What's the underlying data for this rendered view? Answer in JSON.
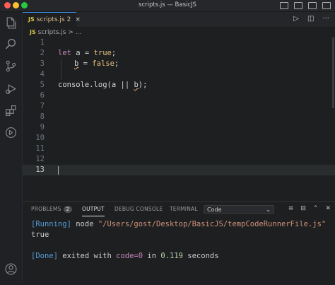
{
  "window": {
    "title": "scripts.js — BasicJS"
  },
  "tab": {
    "lang_badge": "JS",
    "name": "scripts.js",
    "problem_count": "2",
    "close": "×"
  },
  "breadcrumb": {
    "lang_badge": "JS",
    "path": "scripts.js",
    "separator": ">",
    "ellipsis": "..."
  },
  "editor": {
    "line_numbers": [
      "1",
      "2",
      "3",
      "4",
      "5",
      "6",
      "7",
      "8",
      "9",
      "10",
      "11",
      "12",
      "13"
    ],
    "current_line": "13",
    "lines": {
      "l2_let": "let",
      "l2_rest": " a = ",
      "l2_val": "true",
      "l2_end": ";",
      "l3_var": "b",
      "l3_rest": " = ",
      "l3_val": "false",
      "l3_end": ";",
      "l5_fn": "console.log(a || ",
      "l5_arg": "b",
      "l5_end": ");"
    }
  },
  "panel": {
    "tabs": {
      "problems": "PROBLEMS",
      "problems_count": "2",
      "output": "OUTPUT",
      "debug_console": "DEBUG CONSOLE",
      "terminal": "TERMINAL"
    },
    "output_channel": "Code",
    "output_lines": {
      "run_tag": "[Running]",
      "run_cmd": " node ",
      "run_path": "\"/Users/gost/Desktop/BasicJS/tempCodeRunnerFile.js\"",
      "result": "true",
      "done_tag": "[Done]",
      "done_text1": " exited with ",
      "done_code": "code=0",
      "done_text2": " in ",
      "done_time": "0.119",
      "done_text3": " seconds"
    }
  },
  "colors": {
    "accent": "#3b8eea",
    "keyword": "#c586c0",
    "boolean": "#e5c07b",
    "output_tag": "#569cd6"
  }
}
